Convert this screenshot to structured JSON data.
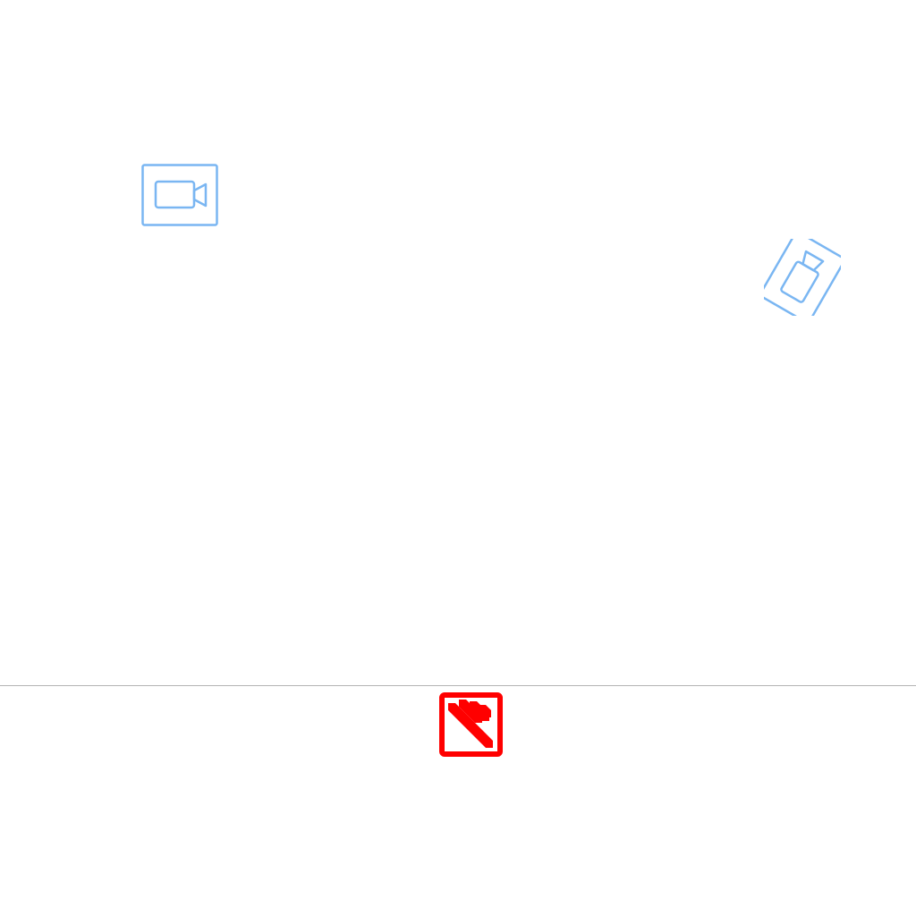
{
  "colors": {
    "background": "#ffffff",
    "camera_tile_stroke": "#7ab6f2",
    "divider": "#b3b3b3",
    "drop_target": "#ff0000"
  },
  "canvas": {
    "items": [
      {
        "icon": "video-camera-icon",
        "rotation_deg": 0
      },
      {
        "icon": "video-camera-icon",
        "rotation_deg": 30
      }
    ]
  },
  "tray": {
    "target_icon": "striped-square-icon"
  }
}
